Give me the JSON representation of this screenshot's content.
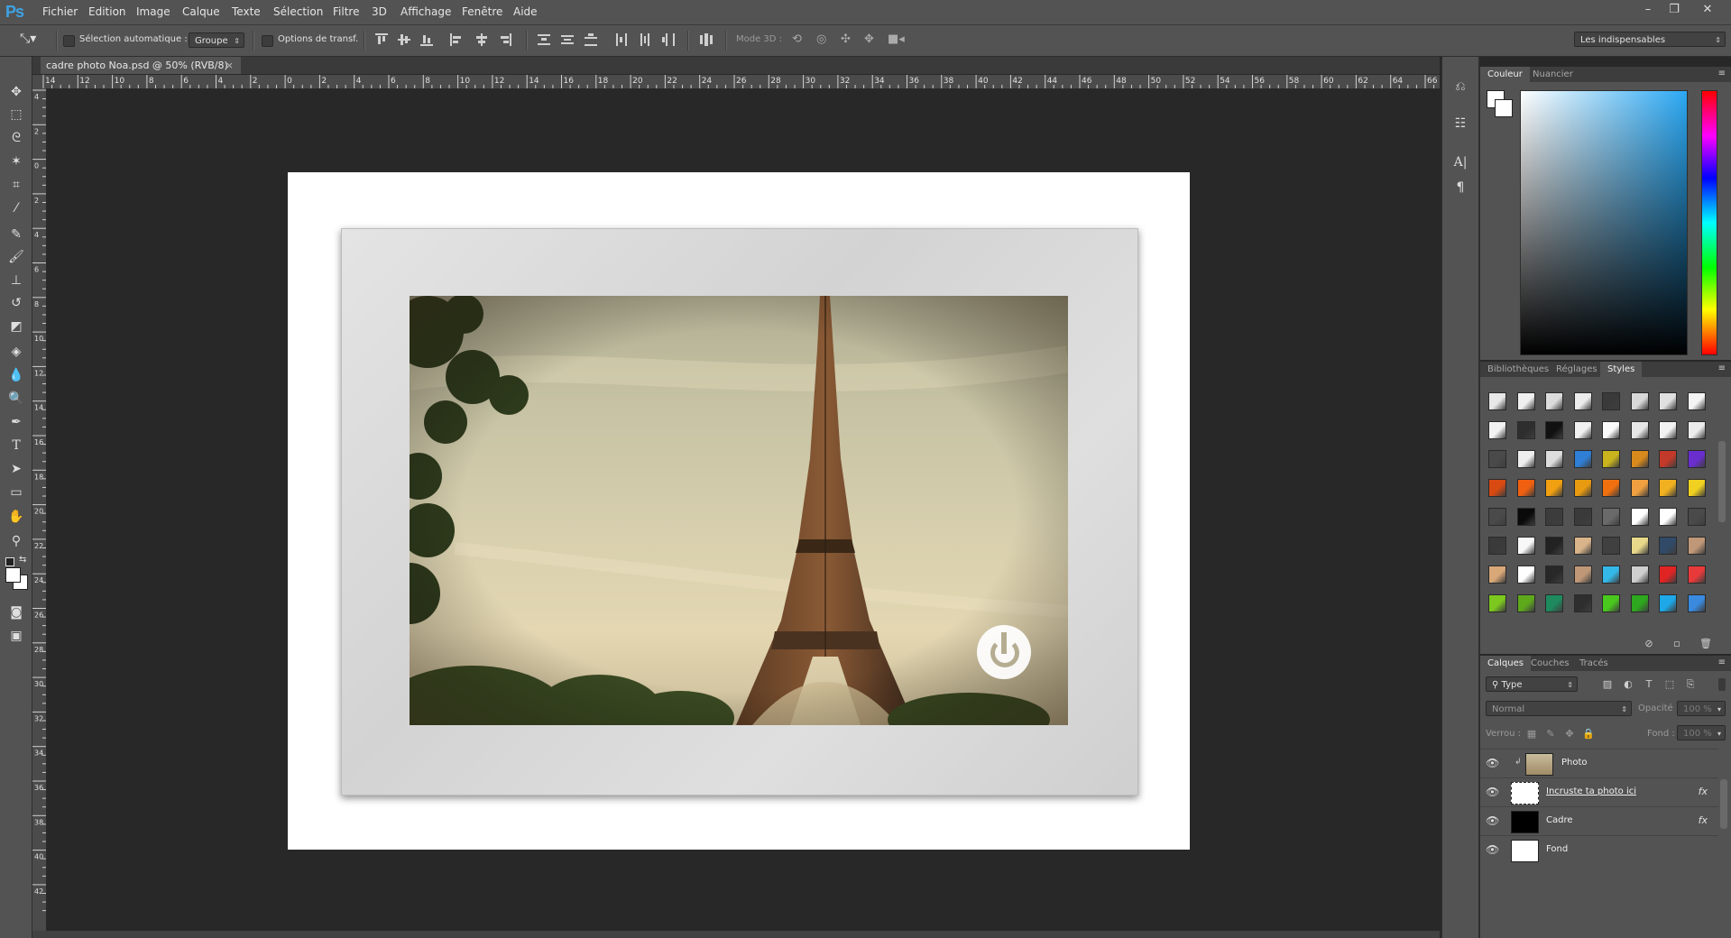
{
  "app": {
    "logo": "Ps"
  },
  "menu": [
    "Fichier",
    "Edition",
    "Image",
    "Calque",
    "Texte",
    "Sélection",
    "Filtre",
    "3D",
    "Affichage",
    "Fenêtre",
    "Aide"
  ],
  "window_controls": {
    "minimize": "–",
    "restore": "❐",
    "close": "✕"
  },
  "options": {
    "auto_select_label": "Sélection automatique :",
    "auto_select_value": "Groupe",
    "transform_label": "Options de transf.",
    "mode3d_label": "Mode 3D :",
    "workspace": "Les indispensables"
  },
  "document": {
    "tab_title": "cadre photo Noa.psd @ 50% (RVB/8)",
    "close": "×"
  },
  "ruler": {
    "h": [
      "14",
      "12",
      "10",
      "8",
      "6",
      "4",
      "2",
      "0",
      "2",
      "4",
      "6",
      "8",
      "10",
      "12",
      "14",
      "16",
      "18",
      "20",
      "22",
      "24",
      "26",
      "28",
      "30",
      "32",
      "34",
      "36",
      "38",
      "40",
      "42",
      "44",
      "46",
      "48",
      "50",
      "52",
      "54",
      "56",
      "58",
      "60",
      "62",
      "64",
      "66"
    ],
    "v": [
      "4",
      "2",
      "0",
      "2",
      "4",
      "6",
      "8",
      "10",
      "12",
      "14",
      "16",
      "18",
      "20",
      "22",
      "24",
      "26",
      "28",
      "30",
      "32",
      "34",
      "36",
      "38",
      "40",
      "42"
    ]
  },
  "tools": [
    "move-tool",
    "marquee-tool",
    "lasso-tool",
    "magic-wand-tool",
    "crop-tool",
    "eyedropper-tool",
    "healing-brush-tool",
    "brush-tool",
    "stamp-tool",
    "history-brush-tool",
    "eraser-tool",
    "paint-bucket-tool",
    "blur-tool",
    "dodge-tool",
    "pen-tool",
    "type-tool",
    "path-selection-tool",
    "shape-tool",
    "hand-tool",
    "zoom-tool"
  ],
  "color_panel": {
    "tabs": [
      "Couleur",
      "Nuancier"
    ],
    "active": "Couleur",
    "fg": "#ffffff",
    "bg": "#ffffff",
    "field_hue": "#2ba8f3"
  },
  "styles_panel": {
    "tabs": [
      "Bibliothèques",
      "Réglages",
      "Styles"
    ],
    "active": "Styles",
    "swatches": [
      [
        "#e8e8e8",
        "#f0f0f0",
        "#dcdcdc",
        "#ececec",
        "#3a3a3a",
        "#d8d8d8",
        "#e0e0e0",
        "#f4f4f4"
      ],
      [
        "#f2f2f2",
        "#2e2e2e",
        "#111111",
        "#f0f0f0",
        "#fafafa",
        "#e6e6e6",
        "#f2f2f2",
        "#ececec"
      ],
      [
        "#4a4a4a",
        "#eeeeee",
        "#dddddd",
        "#2f7fd6",
        "#c9b41d",
        "#d98a1d",
        "#c33a2a",
        "#6a2ecf"
      ],
      [
        "#d84a12",
        "#f06010",
        "#f0a010",
        "#e89a10",
        "#f07010",
        "#f0a040",
        "#f0b020",
        "#f0d020"
      ],
      [
        "#4a4a4a",
        "#0a0a0a",
        "#3c3c3c",
        "#3a3a3a",
        "#6a6a6a",
        "#ffffff",
        "#ffffff",
        "#4a4a4a"
      ],
      [
        "#3a3a3a",
        "#f8f8f8",
        "#222222",
        "#d9b48a",
        "#404040",
        "#e8d88a",
        "#304a68",
        "#c09878"
      ],
      [
        "#d9a878",
        "#ffffff",
        "#282828",
        "#c09878",
        "#34b8e8",
        "#cfcfcf",
        "#e02424",
        "#e83a3a"
      ],
      [
        "#7cc81e",
        "#5ea81c",
        "#1e8a5e",
        "#2e2e2e",
        "#4ac81e",
        "#2ea81e",
        "#1ea8e8",
        "#3a8ae0"
      ]
    ]
  },
  "layers_panel": {
    "tabs": [
      "Calques",
      "Couches",
      "Tracés"
    ],
    "active": "Calques",
    "filter": "Type",
    "blend_mode": "Normal",
    "opacity_label": "Opacité :",
    "opacity_value": "100 %",
    "lock_label": "Verrou :",
    "fill_label": "Fond :",
    "fill_value": "100 %",
    "layers": [
      {
        "name": "Photo",
        "fx": ""
      },
      {
        "name": "Incruste ta photo ici",
        "fx": "fx"
      },
      {
        "name": "Cadre",
        "fx": "fx"
      },
      {
        "name": "Fond",
        "fx": ""
      }
    ]
  }
}
